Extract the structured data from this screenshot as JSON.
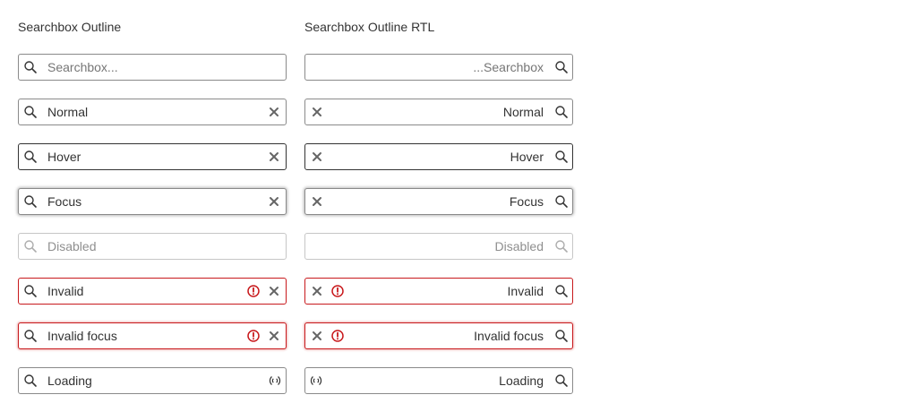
{
  "columns": {
    "ltr": {
      "title": "Searchbox Outline"
    },
    "rtl": {
      "title": "Searchbox Outline RTL"
    }
  },
  "rows": [
    {
      "state": "placeholder",
      "ltr_text": "Searchbox...",
      "rtl_text": "...Searchbox"
    },
    {
      "state": "normal",
      "text": "Normal"
    },
    {
      "state": "hover",
      "text": "Hover"
    },
    {
      "state": "focus",
      "text": "Focus"
    },
    {
      "state": "disabled",
      "text": "Disabled"
    },
    {
      "state": "invalid",
      "text": "Invalid"
    },
    {
      "state": "invalid-focus",
      "text": "Invalid focus"
    },
    {
      "state": "loading",
      "text": "Loading"
    }
  ],
  "icons": {
    "search": "search-icon",
    "clear": "close-icon",
    "error": "error-icon",
    "loading": "loading-icon"
  },
  "colors": {
    "border": "#8a8a8a",
    "border_hover": "#333333",
    "border_disabled": "#c6c6c6",
    "invalid": "#c8191c",
    "text": "#333333",
    "placeholder": "#767676"
  }
}
